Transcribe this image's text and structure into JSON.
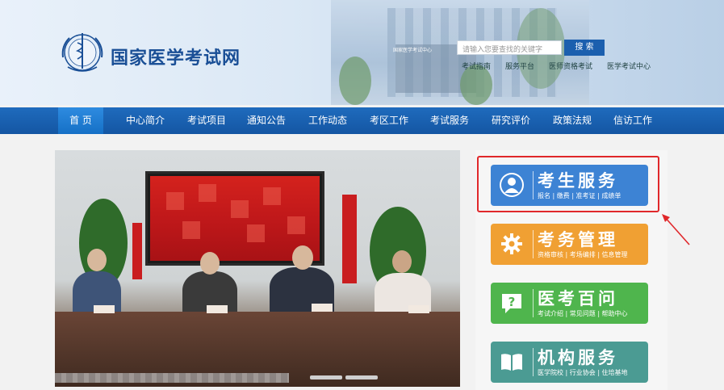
{
  "header": {
    "site_title": "国家医学考试网",
    "building_sign": "国家医学考试中心",
    "search": {
      "placeholder": "请输入您要查找的关键字",
      "button_label": "搜 索"
    },
    "quick_links": [
      "考试指南",
      "服务平台",
      "医师资格考试",
      "医学考试中心"
    ]
  },
  "nav": {
    "items": [
      {
        "label": "首 页",
        "active": true
      },
      {
        "label": "中心简介"
      },
      {
        "label": "考试项目"
      },
      {
        "label": "通知公告"
      },
      {
        "label": "工作动态"
      },
      {
        "label": "考区工作"
      },
      {
        "label": "考试服务"
      },
      {
        "label": "研究评价"
      },
      {
        "label": "政策法规"
      },
      {
        "label": "信访工作"
      }
    ]
  },
  "services": [
    {
      "title": "考生服务",
      "subtitle": "报名 | 缴费 | 准考证 | 成绩单",
      "color": "#3d83d4",
      "icon": "person-icon"
    },
    {
      "title": "考务管理",
      "subtitle": "资格审核 | 考场编排 | 信息管理",
      "color": "#f0a033",
      "icon": "gear-icon"
    },
    {
      "title": "医考百问",
      "subtitle": "考试介绍 | 常见问题 | 帮助中心",
      "color": "#4fb54d",
      "icon": "question-chat-icon"
    },
    {
      "title": "机构服务",
      "subtitle": "医学院校 | 行业协会 | 住培基地",
      "color": "#4b9b93",
      "icon": "book-icon"
    }
  ],
  "colors": {
    "nav_bg": "#1a5eab",
    "highlight": "#e0282b",
    "logo_text": "#1a4f96"
  }
}
